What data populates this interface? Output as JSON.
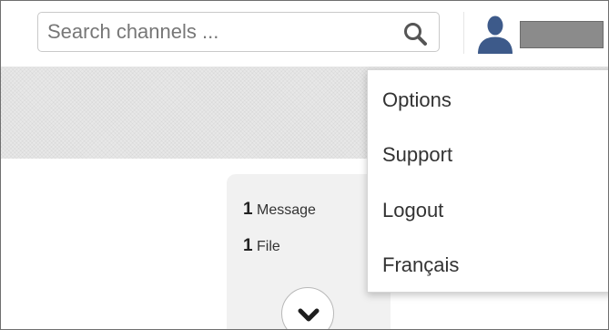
{
  "search": {
    "placeholder": "Search channels ..."
  },
  "icons": {
    "search": "search-icon",
    "avatar": "user-silhouette-icon",
    "expand": "chevron-down-icon"
  },
  "colors": {
    "avatar": "#3d5a8a",
    "redacted_name": "#8b8b8b",
    "background_hatch": "#e8e8e8",
    "card_background": "#f1f1f1"
  },
  "card": {
    "messages": {
      "count": "1",
      "label": "Message"
    },
    "files": {
      "count": "1",
      "label": "File"
    }
  },
  "dropdown": {
    "items": [
      {
        "label": "Options"
      },
      {
        "label": "Support"
      },
      {
        "label": "Logout"
      },
      {
        "label": "Français"
      }
    ]
  }
}
